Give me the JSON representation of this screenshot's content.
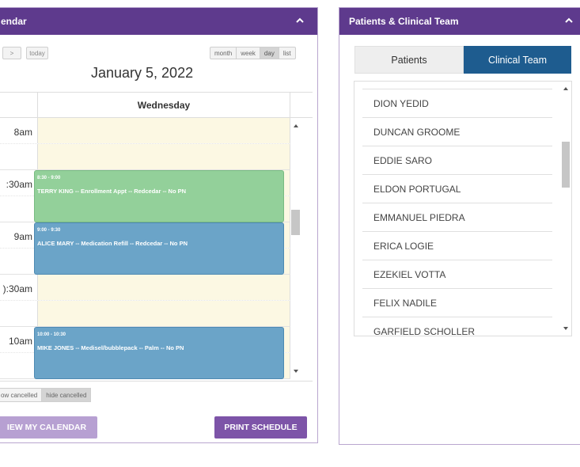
{
  "calendar": {
    "header_title": "endar",
    "next_label": ">",
    "today_label": "today",
    "date_title": "January 5, 2022",
    "view_buttons": [
      "month",
      "week",
      "day",
      "list"
    ],
    "active_view": "day",
    "day_header": "Wednesday",
    "time_labels": [
      "8am",
      ":30am",
      "9am",
      "):30am",
      "10am"
    ],
    "events": [
      {
        "time": "8:30 - 9:00",
        "title": "TERRY KING -- Enrollment Appt -- Redcedar -- No PN",
        "color": "#93d09a"
      },
      {
        "time": "9:00 - 9:30",
        "title": "ALICE MARY -- Medication Refill -- Redcedar -- No PN",
        "color": "#6ba4c8"
      },
      {
        "time": "10:00 - 10:30",
        "title": "MIKE JONES -- Medisel/bubblepack -- Palm -- No PN",
        "color": "#6ba4c8"
      }
    ],
    "cancel_buttons": [
      "ow cancelled",
      "hide cancelled"
    ],
    "view_calendar_label": "IEW MY CALENDAR",
    "print_label": "PRINT SCHEDULE",
    "colors": {
      "header": "#5e3a8d",
      "slot_bg": "#fcf8e3",
      "print": "#7d54a8",
      "view_cal": "#b7a0d2"
    }
  },
  "patients_panel": {
    "header_title": "Patients & Clinical Team",
    "tabs": [
      {
        "label": "Patients",
        "active": false
      },
      {
        "label": "Clinical Team",
        "active": true
      }
    ],
    "list_items": [
      "DION YEDID",
      "DUNCAN GROOME",
      "EDDIE SARO",
      "ELDON PORTUGAL",
      "EMMANUEL PIEDRA",
      "ERICA LOGIE",
      "EZEKIEL VOTTA",
      "FELIX NADILE",
      "GARFIELD SCHOLLER"
    ],
    "colors": {
      "header": "#5e3a8d",
      "active_tab": "#1e5c8f"
    }
  }
}
